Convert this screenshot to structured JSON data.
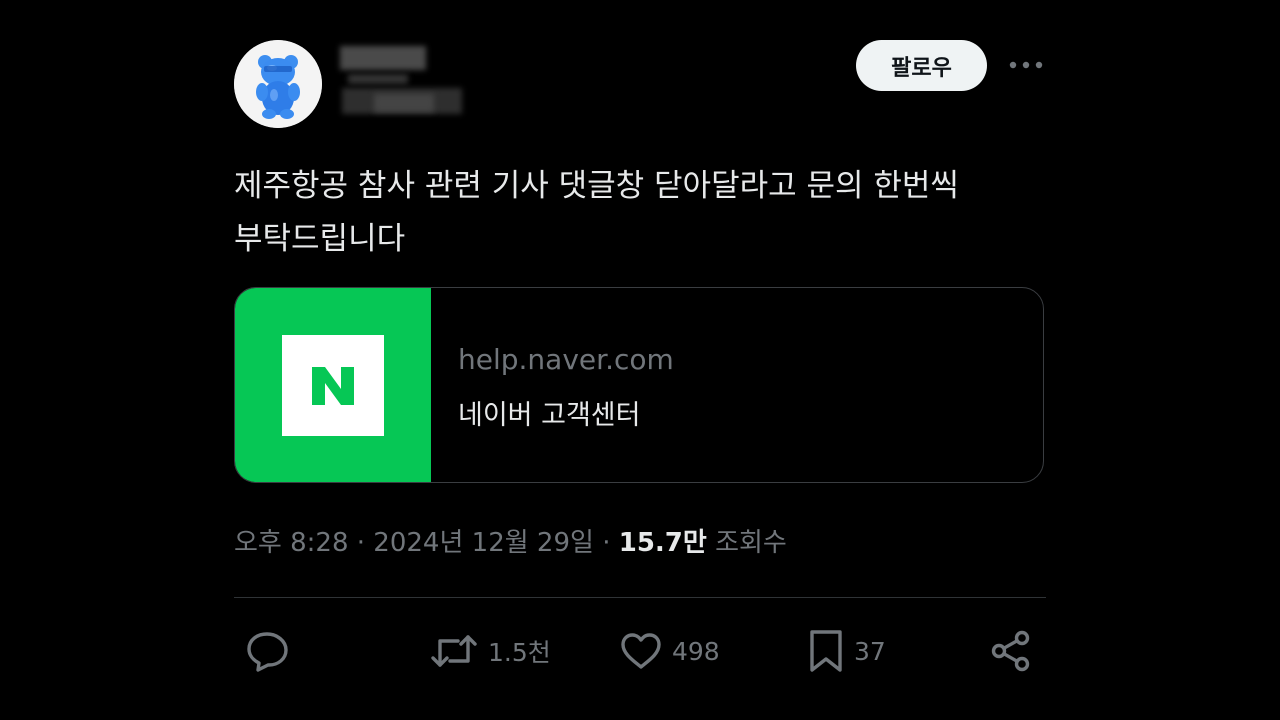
{
  "post": {
    "author_avatar_icon": "gummy-bear-avatar-icon",
    "follow_label": "팔로우",
    "more_icon": "more-dots-icon",
    "text": "제주항공 참사 관련 기사 댓글창 닫아달라고 문의 한번씩\n부탁드립니다"
  },
  "link_card": {
    "logo_letter": "N",
    "logo_color": "#06c755",
    "domain": "help.naver.com",
    "title": "네이버 고객센터"
  },
  "meta": {
    "time": "오후 8:28",
    "date": "2024년 12월 29일",
    "separator": "·",
    "views_count": "15.7만",
    "views_label": "조회수"
  },
  "actions": {
    "reply_icon": "reply-icon",
    "repost_icon": "repost-icon",
    "repost_count": "1.5천",
    "like_icon": "heart-icon",
    "like_count": "498",
    "bookmark_icon": "bookmark-icon",
    "bookmark_count": "37",
    "share_icon": "share-icon"
  },
  "colors": {
    "background": "#000000",
    "text_primary": "#e7e9ea",
    "text_secondary": "#71767b",
    "border": "#2f3336",
    "naver_green": "#06c755"
  }
}
